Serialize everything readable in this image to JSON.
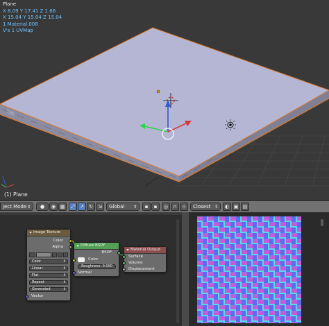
{
  "viewport": {
    "stats": {
      "object_name": "Plane",
      "line1": "X 8.09 Y 17.41 Z 1.66",
      "line2": "X 15.04 Y 15.04 Z 15.04",
      "line3": "1 Material.008",
      "line4": "V's 1 UVMap"
    },
    "object_label": "(1) Plane"
  },
  "header": {
    "mode": "ject Mode",
    "pivot": "Global",
    "snap": "Closest"
  },
  "node_editor": {
    "image_texture": {
      "title": "Image Texture",
      "out_color": "Color",
      "out_alpha": "Alpha",
      "colorspace": "Color",
      "interpolation": "Linear",
      "projection": "Flat",
      "extension": "Repeat",
      "source": "Generated",
      "in_vector": "Vector"
    },
    "diffuse": {
      "title": "Diffuse BSDF",
      "out_bsdf": "BSDF",
      "color_label": "Color",
      "roughness": "Roughness: 0.000",
      "normal": "Normal"
    },
    "output": {
      "title": "Material Output",
      "surface": "Surface",
      "volume": "Volume",
      "displacement": "Displacement"
    }
  },
  "colors": {
    "selected_outline": "#e07b28",
    "plane_top": "#b5b6d4",
    "texture_blue": "#5c6cf0",
    "texture_magenta": "#c55bd8",
    "texture_cyan": "#5fd6e6"
  }
}
